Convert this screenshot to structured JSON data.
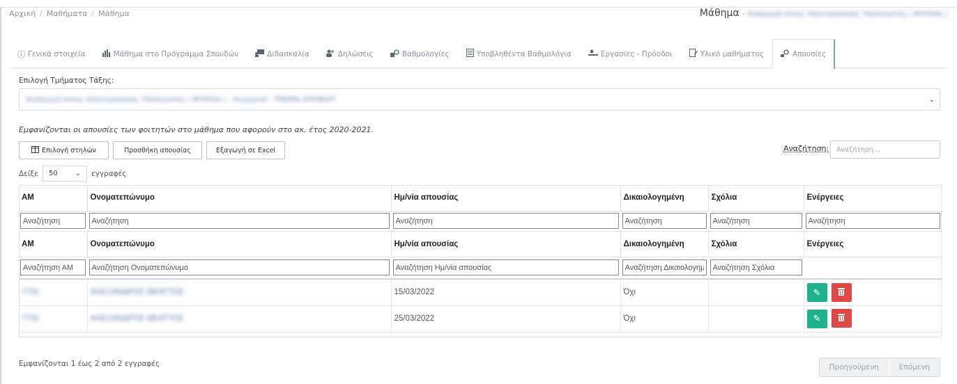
{
  "breadcrumb": [
    "Αρχική",
    "Μαθήματα",
    "Μάθημα"
  ],
  "header": {
    "title": "Μάθημα",
    "subtitle": "Εισαγωγή στους Ηλεκτρονικούς Υπολογιστές ( ΦΥΟ54α )"
  },
  "tabs": [
    {
      "label": "Γενικά στοιχεία",
      "icon": "info-circle-icon"
    },
    {
      "label": "Μάθημα στο Πρόγραμμα Σπουδών",
      "icon": "bar-chart-icon"
    },
    {
      "label": "Διδασκαλία",
      "icon": "teacher-board-icon"
    },
    {
      "label": "Δηλώσεις",
      "icon": "users-icon"
    },
    {
      "label": "Βαθμολογίες",
      "icon": "grades-icon"
    },
    {
      "label": "Υποβληθέντα Βαθμολόγια",
      "icon": "document-list-icon"
    },
    {
      "label": "Εργασίες - Πρόοδοι",
      "icon": "assignment-icon"
    },
    {
      "label": "Υλικό μαθήματος",
      "icon": "material-icon"
    },
    {
      "label": "Απουσίες",
      "icon": "absence-icon"
    }
  ],
  "active_tab": "Απουσίες",
  "section_select": {
    "label": "Επιλογή Τμήματος Τάξης:",
    "value": "Εισαγωγή στους Ηλεκτρονικούς Υπολογιστές ( ΦΥΟ54α ) - Χειμερινό - ΤΜΗΜΑ ΑΠΟΦΟΙΤ"
  },
  "note": "Εμφανίζονται οι απουσίες των φοιτητών στο μάθημα που αφορούν στο ακ. έτος 2020-2021.",
  "buttons": {
    "columns": "Επιλογή στηλών",
    "add": "Προσθήκη απουσίας",
    "export": "Εξαγωγή σε Excel"
  },
  "search": {
    "label": "Αναζήτηση:",
    "placeholder": "Αναζήτηση..."
  },
  "length": {
    "prefix": "Δείξε",
    "value": "50",
    "suffix": "εγγραφές"
  },
  "table": {
    "headers": [
      "ΑΜ",
      "Ονοματεπώνυμο",
      "Ημ/νία απουσίας",
      "Δικαιολογημένη",
      "Σχόλια",
      "Ενέργειες"
    ],
    "filter_placeholder": "Αναζήτηση",
    "filters2": [
      "Αναζήτηση ΑΜ",
      "Αναζήτηση Ονοματεπώνυμο",
      "Αναζήτηση Ημ/νία απουσίας",
      "Αναζήτηση Δικαιολογημένη",
      "Αναζήτηση Σχόλια"
    ],
    "rows": [
      {
        "am": "7731",
        "name": "ΑΛΕΞΑΝΔΡΟΣ ΘΕΑΤΤΟΣ",
        "date": "15/03/2022",
        "justified": "Όχι",
        "comments": ""
      },
      {
        "am": "7731",
        "name": "ΑΛΕΞΑΝΔΡΟΣ ΘΕΑΤΤΟΣ",
        "date": "25/03/2022",
        "justified": "Όχι",
        "comments": ""
      }
    ]
  },
  "info": "Εμφανίζονται 1 έως 2 από 2 εγγραφές",
  "pager": {
    "prev": "Προηγούμενη",
    "next": "Επόμενη"
  },
  "colors": {
    "edit": "#1eb28a",
    "delete": "#e04848"
  }
}
